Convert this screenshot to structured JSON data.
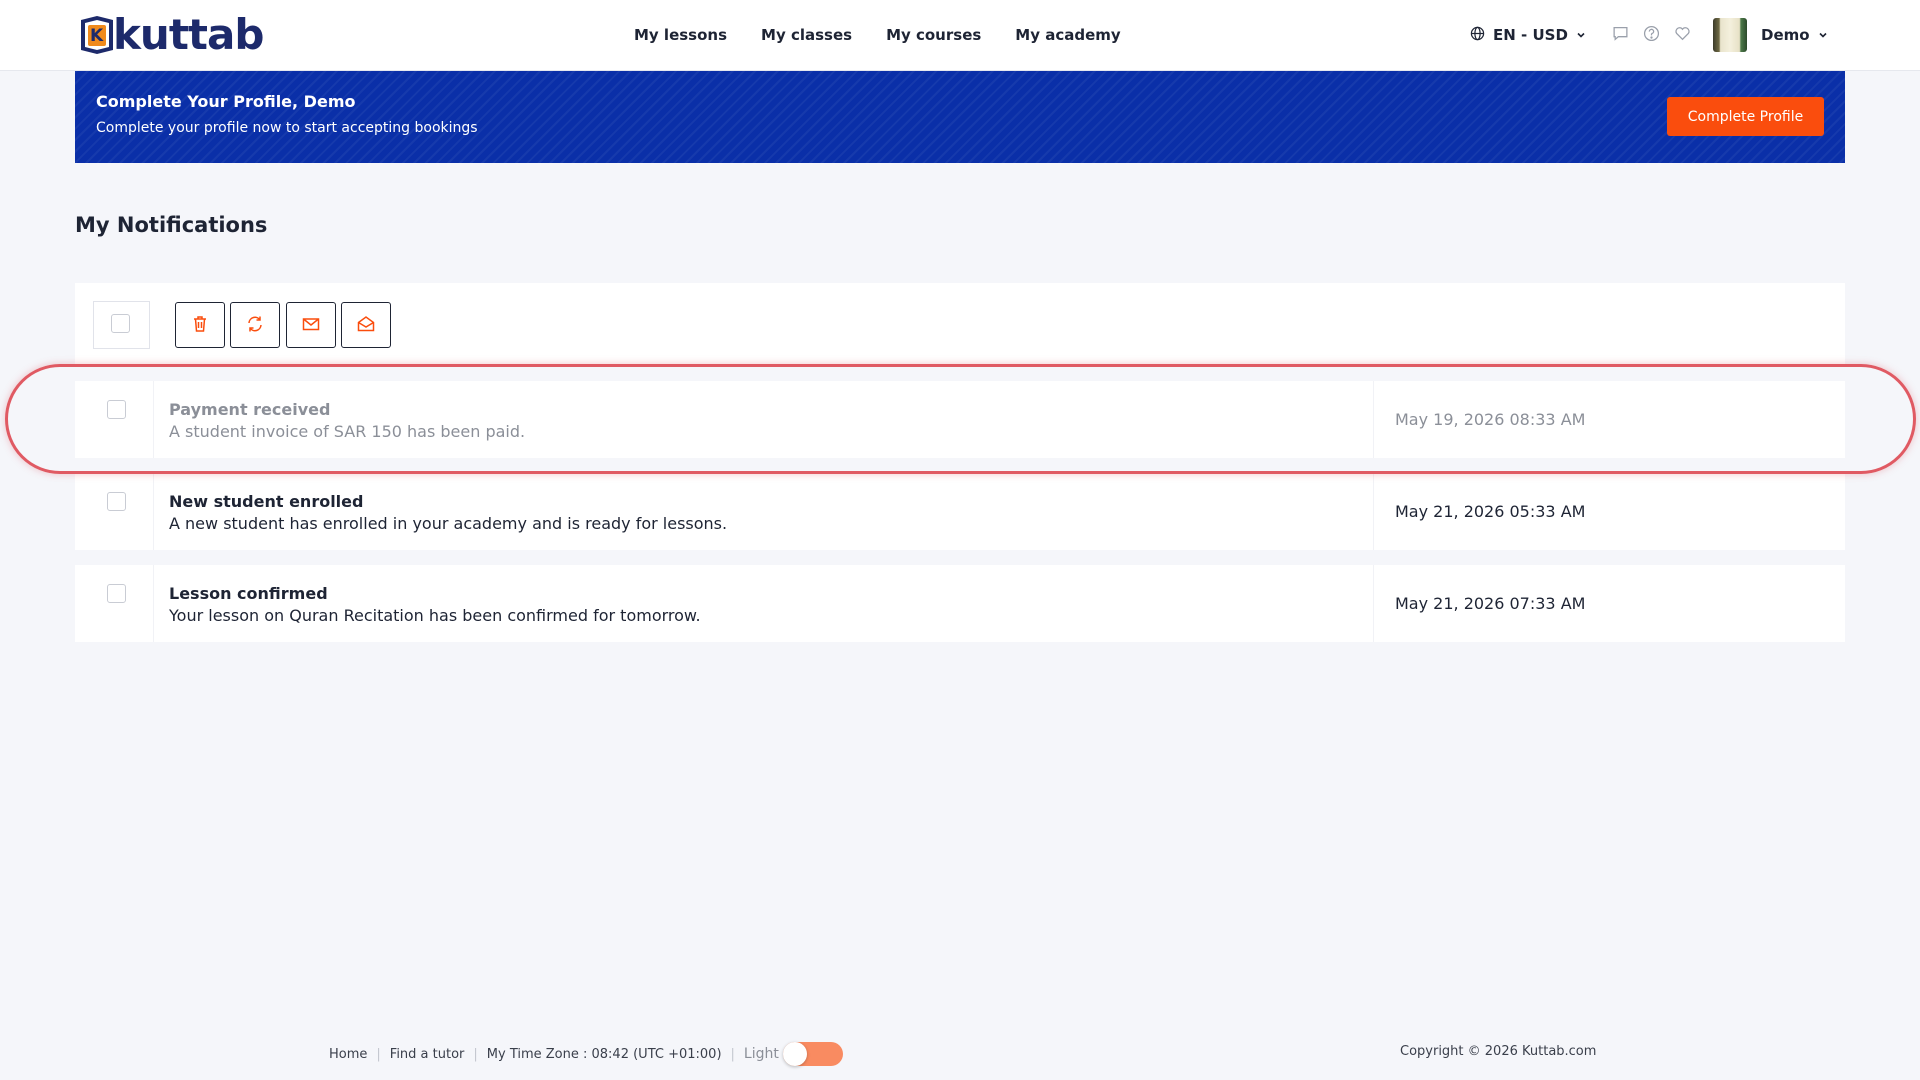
{
  "brand": {
    "name": "kuttab",
    "badge_letter": "K"
  },
  "nav": {
    "items": [
      "My lessons",
      "My classes",
      "My courses",
      "My academy"
    ]
  },
  "header": {
    "language": "EN - USD",
    "user_name": "Demo"
  },
  "banner": {
    "title": "Complete Your Profile, Demo",
    "subtitle": "Complete your profile now to start accepting bookings",
    "button_label": "Complete Profile"
  },
  "page": {
    "title": "My Notifications"
  },
  "colors": {
    "accent": "#fa4d0d",
    "banner": "#0a2fa8",
    "highlight": "#e05a63"
  },
  "toolbar": {
    "icons": [
      "trash-icon",
      "refresh-icon",
      "envelope-closed-icon",
      "envelope-open-icon"
    ]
  },
  "notifications": [
    {
      "title": "Payment received",
      "message": "A student invoice of SAR 150 has been paid.",
      "date": "May 19, 2026 08:33 AM",
      "read": true
    },
    {
      "title": "New student enrolled",
      "message": "A new student has enrolled in your academy and is ready for lessons.",
      "date": "May 21, 2026 05:33 AM",
      "read": false
    },
    {
      "title": "Lesson confirmed",
      "message": "Your lesson on Quran Recitation has been confirmed for tomorrow.",
      "date": "May 21, 2026 07:33 AM",
      "read": false
    }
  ],
  "footer": {
    "links": [
      "Home",
      "Find a tutor"
    ],
    "timezone": "My Time Zone : 08:42 (UTC +01:00)",
    "theme_label": "Light",
    "copyright": "Copyright © 2026 Kuttab.com"
  }
}
